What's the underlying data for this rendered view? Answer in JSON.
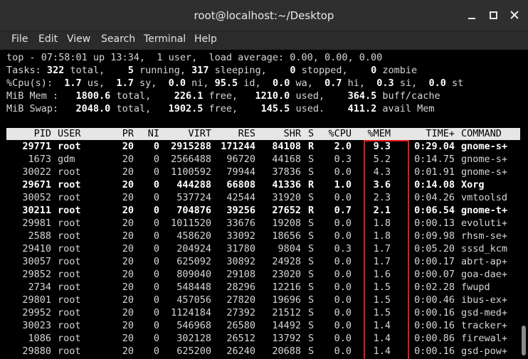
{
  "window": {
    "title": "root@localhost:~/Desktop",
    "min_icon": "minimize-icon",
    "max_icon": "maximize-icon",
    "close_icon": "close-icon"
  },
  "menu": [
    "File",
    "Edit",
    "View",
    "Search",
    "Terminal",
    "Help"
  ],
  "summary": {
    "line1": "top - 07:58:01 up 13:34,  1 user,  load average: 0.00, 0.00, 0.00",
    "tasks": {
      "label": "Tasks:",
      "total": "322",
      "running": "5",
      "sleeping": "317",
      "stopped": "0",
      "zombie": "0"
    },
    "cpu": {
      "us": "1.7",
      "sy": "1.7",
      "ni": "0.0",
      "id": "95.5",
      "wa": "0.0",
      "hi": "0.7",
      "si": "0.3",
      "st": "0.0"
    },
    "mem": {
      "total": "1800.6",
      "free": "226.1",
      "used": "1210.0",
      "buff": "364.5"
    },
    "swap": {
      "total": "2048.0",
      "free": "1902.5",
      "used": "145.5",
      "avail": "411.2"
    }
  },
  "table": {
    "headers": [
      "PID",
      "USER",
      "PR",
      "NI",
      "VIRT",
      "RES",
      "SHR",
      "S",
      "%CPU",
      "%MEM",
      "TIME+",
      "COMMAND"
    ],
    "rows": [
      [
        "29771",
        "root",
        "20",
        "0",
        "2915288",
        "171244",
        "84108",
        "R",
        "2.0",
        "9.3",
        "0:29.04",
        "gnome-s+",
        true
      ],
      [
        "1673",
        "gdm",
        "20",
        "0",
        "2566488",
        "96720",
        "44168",
        "S",
        "0.3",
        "5.2",
        "0:14.75",
        "gnome-s+",
        false
      ],
      [
        "30022",
        "root",
        "20",
        "0",
        "1100592",
        "79944",
        "37836",
        "S",
        "0.0",
        "4.3",
        "0:01.91",
        "gnome-s+",
        false
      ],
      [
        "29671",
        "root",
        "20",
        "0",
        "444288",
        "66808",
        "41336",
        "R",
        "1.0",
        "3.6",
        "0:14.08",
        "Xorg",
        true
      ],
      [
        "30052",
        "root",
        "20",
        "0",
        "537724",
        "42544",
        "31920",
        "S",
        "0.0",
        "2.3",
        "0:04.26",
        "vmtoolsd",
        false
      ],
      [
        "30211",
        "root",
        "20",
        "0",
        "704876",
        "39256",
        "27652",
        "R",
        "0.7",
        "2.1",
        "0:06.54",
        "gnome-t+",
        true
      ],
      [
        "29981",
        "root",
        "20",
        "0",
        "1011520",
        "33676",
        "19208",
        "S",
        "0.0",
        "1.8",
        "0:00.13",
        "evoluti+",
        false
      ],
      [
        "2588",
        "root",
        "20",
        "0",
        "458620",
        "33092",
        "18656",
        "S",
        "0.0",
        "1.8",
        "0:09.98",
        "rhsm-se+",
        false
      ],
      [
        "29410",
        "root",
        "20",
        "0",
        "204924",
        "31780",
        "9804",
        "S",
        "0.3",
        "1.7",
        "0:05.20",
        "sssd_kcm",
        false
      ],
      [
        "30057",
        "root",
        "20",
        "0",
        "625092",
        "30892",
        "24928",
        "S",
        "0.0",
        "1.7",
        "0:00.17",
        "abrt-ap+",
        false
      ],
      [
        "29852",
        "root",
        "20",
        "0",
        "809040",
        "29108",
        "23020",
        "S",
        "0.0",
        "1.6",
        "0:00.07",
        "goa-dae+",
        false
      ],
      [
        "2734",
        "root",
        "20",
        "0",
        "548448",
        "28296",
        "12216",
        "S",
        "0.0",
        "1.5",
        "0:02.28",
        "fwupd",
        false
      ],
      [
        "29801",
        "root",
        "20",
        "0",
        "457056",
        "27820",
        "19696",
        "S",
        "0.0",
        "1.5",
        "0:00.46",
        "ibus-ex+",
        false
      ],
      [
        "29952",
        "root",
        "20",
        "0",
        "1124184",
        "27392",
        "21512",
        "S",
        "0.0",
        "1.5",
        "0:00.16",
        "gsd-med+",
        false
      ],
      [
        "30023",
        "root",
        "20",
        "0",
        "546968",
        "26580",
        "14492",
        "S",
        "0.0",
        "1.4",
        "0:00.16",
        "tracker+",
        false
      ],
      [
        "1086",
        "root",
        "20",
        "0",
        "302128",
        "26512",
        "13792",
        "S",
        "0.0",
        "1.4",
        "0:00.86",
        "firewal+",
        false
      ],
      [
        "29880",
        "root",
        "20",
        "0",
        "625200",
        "26240",
        "20688",
        "S",
        "0.0",
        "1.4",
        "0:00.16",
        "gsd-pow+",
        false
      ]
    ]
  },
  "highlight_color": "#e01818"
}
